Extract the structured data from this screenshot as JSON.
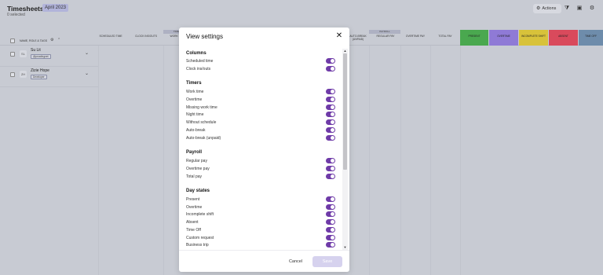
{
  "app": {
    "title": "Timesheets",
    "month": "April 2023",
    "selected": "0 selected",
    "actions_label": "Actions"
  },
  "table": {
    "name_header": "Name, role & tags",
    "columns": [
      "Scheduled time",
      "Clock ins/outs",
      "Work time",
      "Auto-break (unpaid)",
      "Regular pay",
      "Overtime pay",
      "Total pay"
    ],
    "group_labels": [
      "Timers",
      "Payroll",
      "Day states"
    ],
    "day_states": [
      "Present",
      "Overtime",
      "Incomplete shift",
      "Absent",
      "Time off"
    ],
    "colors": {
      "present": "#4aa84f",
      "overtime": "#8f7ad6",
      "incomplete": "#d8c23a",
      "absent": "#d94a5c",
      "time_off": "#6e8cab"
    },
    "employees": [
      {
        "name": "Su Lit",
        "tag": "@prowlingnet"
      },
      {
        "name": "Zizie Hope",
        "tag": "Developer"
      }
    ]
  },
  "modal": {
    "title": "View settings",
    "accent": "#6f3ba8",
    "sections": [
      {
        "title": "Columns",
        "items": [
          "Scheduled time",
          "Clock ins/outs"
        ]
      },
      {
        "title": "Timers",
        "items": [
          "Work time",
          "Overtime",
          "Missing work time",
          "Night time",
          "Without schedule",
          "Auto-break",
          "Auto-break (unpaid)"
        ]
      },
      {
        "title": "Payroll",
        "items": [
          "Regular pay",
          "Overtime pay",
          "Total pay"
        ]
      },
      {
        "title": "Day states",
        "items": [
          "Present",
          "Overtime",
          "Incomplete shift",
          "Absent",
          "Time Off",
          "Custom request",
          "Business trip"
        ]
      }
    ],
    "cancel_label": "Cancel",
    "save_label": "Save"
  }
}
